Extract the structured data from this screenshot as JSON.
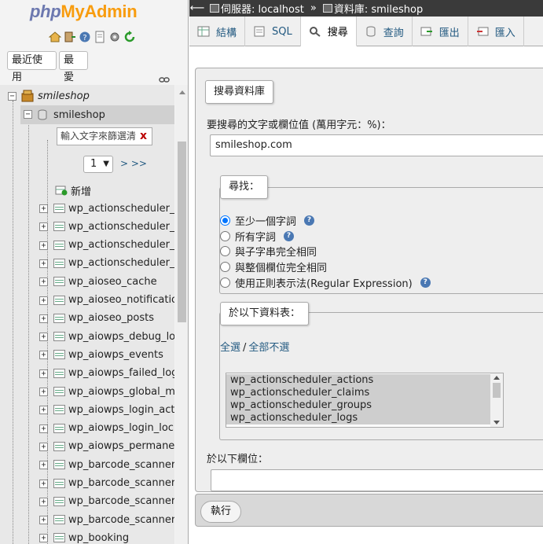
{
  "logo": {
    "part_php": "php",
    "part_my": "My",
    "part_admin": "Admin"
  },
  "nav": {
    "recent_label": "最近使用",
    "favorites_label": "最愛",
    "root_db": "smileshop",
    "db_name": "smileshop",
    "filter_placeholder": "輸入文字來篩選清單",
    "filter_clear": "x",
    "page_value": "1",
    "page_next": "> >>",
    "new_label": "新增",
    "tables": [
      "wp_actionscheduler_actions",
      "wp_actionscheduler_claims",
      "wp_actionscheduler_groups",
      "wp_actionscheduler_logs",
      "wp_aioseo_cache",
      "wp_aioseo_notifications",
      "wp_aioseo_posts",
      "wp_aiowps_debug_log",
      "wp_aiowps_events",
      "wp_aiowps_failed_logins",
      "wp_aiowps_global_meta",
      "wp_aiowps_login_activity",
      "wp_aiowps_login_lockdown",
      "wp_aiowps_permanent_block",
      "wp_barcode_scanner_a",
      "wp_barcode_scanner_b",
      "wp_barcode_scanner_c",
      "wp_barcode_scanner_d",
      "wp_booking"
    ]
  },
  "topbar": {
    "server_label": "伺服器: localhost",
    "separator": "»",
    "db_label": "資料庫: smileshop"
  },
  "tabs": [
    {
      "label": "結構",
      "icon": "structure-icon"
    },
    {
      "label": "SQL",
      "icon": "sql-icon"
    },
    {
      "label": "搜尋",
      "icon": "search-icon"
    },
    {
      "label": "查詢",
      "icon": "query-icon"
    },
    {
      "label": "匯出",
      "icon": "export-icon"
    },
    {
      "label": "匯入",
      "icon": "import-icon"
    }
  ],
  "search": {
    "legend": "搜尋資料庫",
    "prompt": "要搜尋的文字或欄位值 (萬用字元：%)：",
    "criteria_value": "smileshop.com",
    "find_legend": "尋找：",
    "options": [
      {
        "label": "至少一個字詞",
        "checked": true,
        "help": true
      },
      {
        "label": "所有字詞",
        "checked": false,
        "help": true
      },
      {
        "label": "與子字串完全相同",
        "checked": false,
        "help": false
      },
      {
        "label": "與整個欄位完全相同",
        "checked": false,
        "help": false
      },
      {
        "label": "使用正則表示法(Regular Expression)",
        "checked": false,
        "help": true
      }
    ],
    "tables_legend": "於以下資料表：",
    "select_all": "全選",
    "select_sep": "/",
    "select_none": "全部不選",
    "table_options": [
      "wp_actionscheduler_actions",
      "wp_actionscheduler_claims",
      "wp_actionscheduler_groups",
      "wp_actionscheduler_logs"
    ],
    "column_label": "於以下欄位：",
    "column_value": "",
    "go_label": "執行"
  },
  "colors": {
    "link": "#235a81",
    "topbar": "#3a3a3a",
    "radio": "#0075ff"
  }
}
